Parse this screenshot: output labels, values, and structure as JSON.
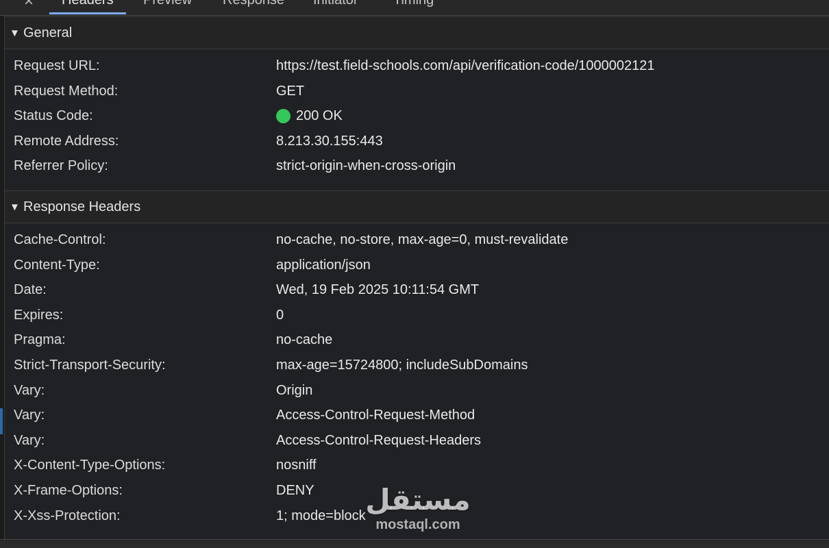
{
  "tabs": {
    "close_label": "×",
    "items": [
      "Headers",
      "Preview",
      "Response",
      "Initiator",
      "Timing"
    ],
    "active": "Headers"
  },
  "general": {
    "title": "General",
    "toggle": "▼",
    "rows": [
      {
        "key": "Request URL:",
        "value": "https://test.field-schools.com/api/verification-code/1000002121"
      },
      {
        "key": "Request Method:",
        "value": "GET"
      },
      {
        "key": "Status Code:",
        "value": "200 OK"
      },
      {
        "key": "Remote Address:",
        "value": "8.213.30.155:443"
      },
      {
        "key": "Referrer Policy:",
        "value": "strict-origin-when-cross-origin"
      }
    ]
  },
  "response_headers": {
    "title": "Response Headers",
    "toggle": "▼",
    "rows": [
      {
        "key": "Cache-Control:",
        "value": "no-cache, no-store, max-age=0, must-revalidate"
      },
      {
        "key": "Content-Type:",
        "value": "application/json"
      },
      {
        "key": "Date:",
        "value": "Wed, 19 Feb 2025 10:11:54 GMT"
      },
      {
        "key": "Expires:",
        "value": "0"
      },
      {
        "key": "Pragma:",
        "value": "no-cache"
      },
      {
        "key": "Strict-Transport-Security:",
        "value": "max-age=15724800; includeSubDomains"
      },
      {
        "key": "Vary:",
        "value": "Origin"
      },
      {
        "key": "Vary:",
        "value": "Access-Control-Request-Method"
      },
      {
        "key": "Vary:",
        "value": "Access-Control-Request-Headers"
      },
      {
        "key": "X-Content-Type-Options:",
        "value": "nosniff"
      },
      {
        "key": "X-Frame-Options:",
        "value": "DENY"
      },
      {
        "key": "X-Xss-Protection:",
        "value": "1; mode=block"
      }
    ]
  },
  "status": {
    "color": "#34c759"
  },
  "watermark": {
    "arabic": "مستقل",
    "latin": "mostaql.com"
  }
}
